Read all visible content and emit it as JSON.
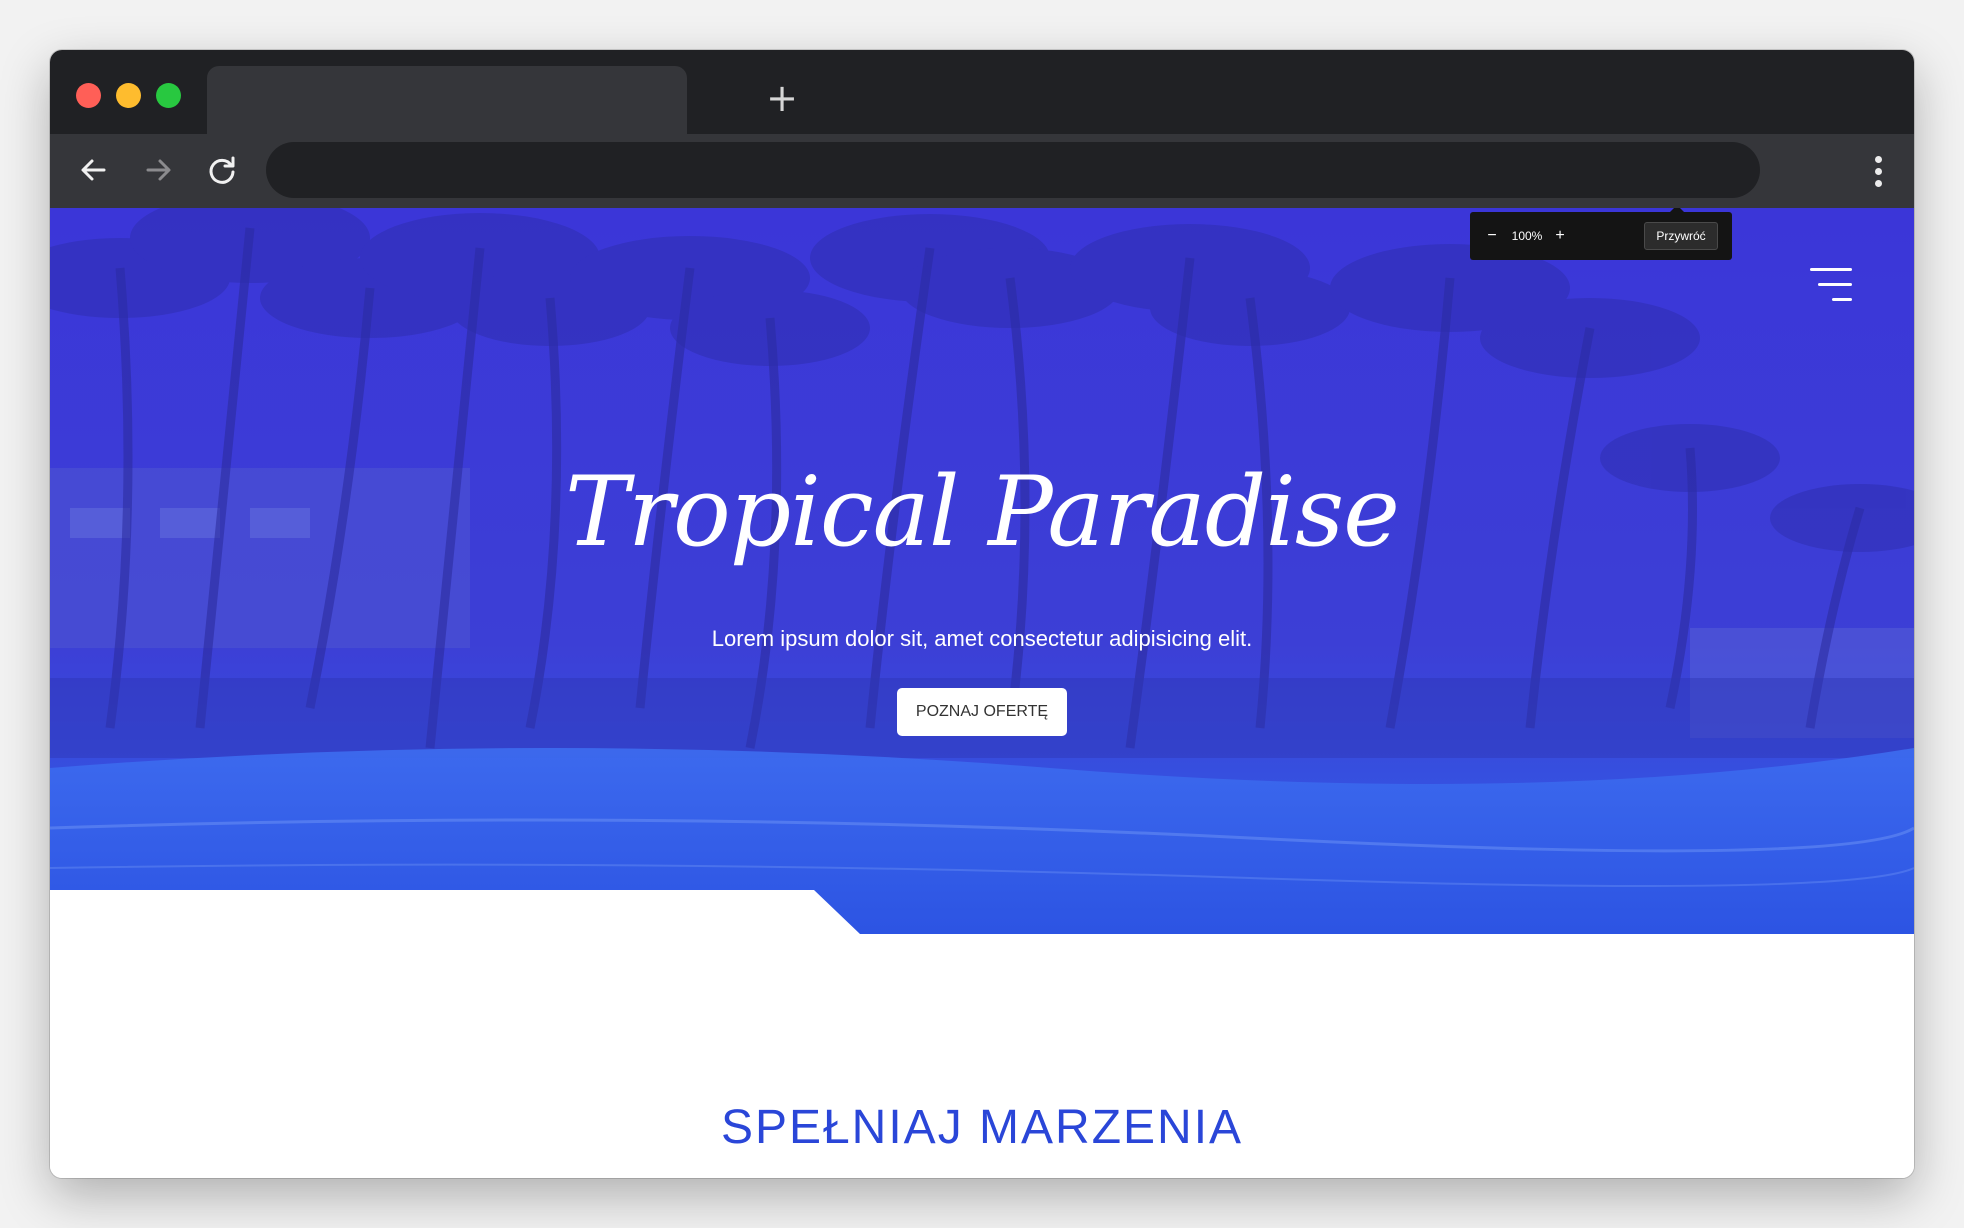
{
  "browser": {
    "new_tab_glyph": "+",
    "menu_icon": "kebab-menu-icon",
    "back_icon": "arrow-left-icon",
    "forward_icon": "arrow-right-icon",
    "reload_icon": "reload-icon"
  },
  "zoom_popup": {
    "minus": "−",
    "level": "100%",
    "plus": "+",
    "reset_label": "Przywróć"
  },
  "hero": {
    "title": "Tropical Paradise",
    "subtitle": "Lorem ipsum dolor sit, amet consectetur adipisicing elit.",
    "cta_label": "POZNAJ OFERTĘ",
    "menu_icon": "hamburger-menu-icon",
    "overlay_color": "#3a33d6"
  },
  "section": {
    "title": "SPEŁNIAJ MARZENIA",
    "title_color": "#2a46d8"
  }
}
